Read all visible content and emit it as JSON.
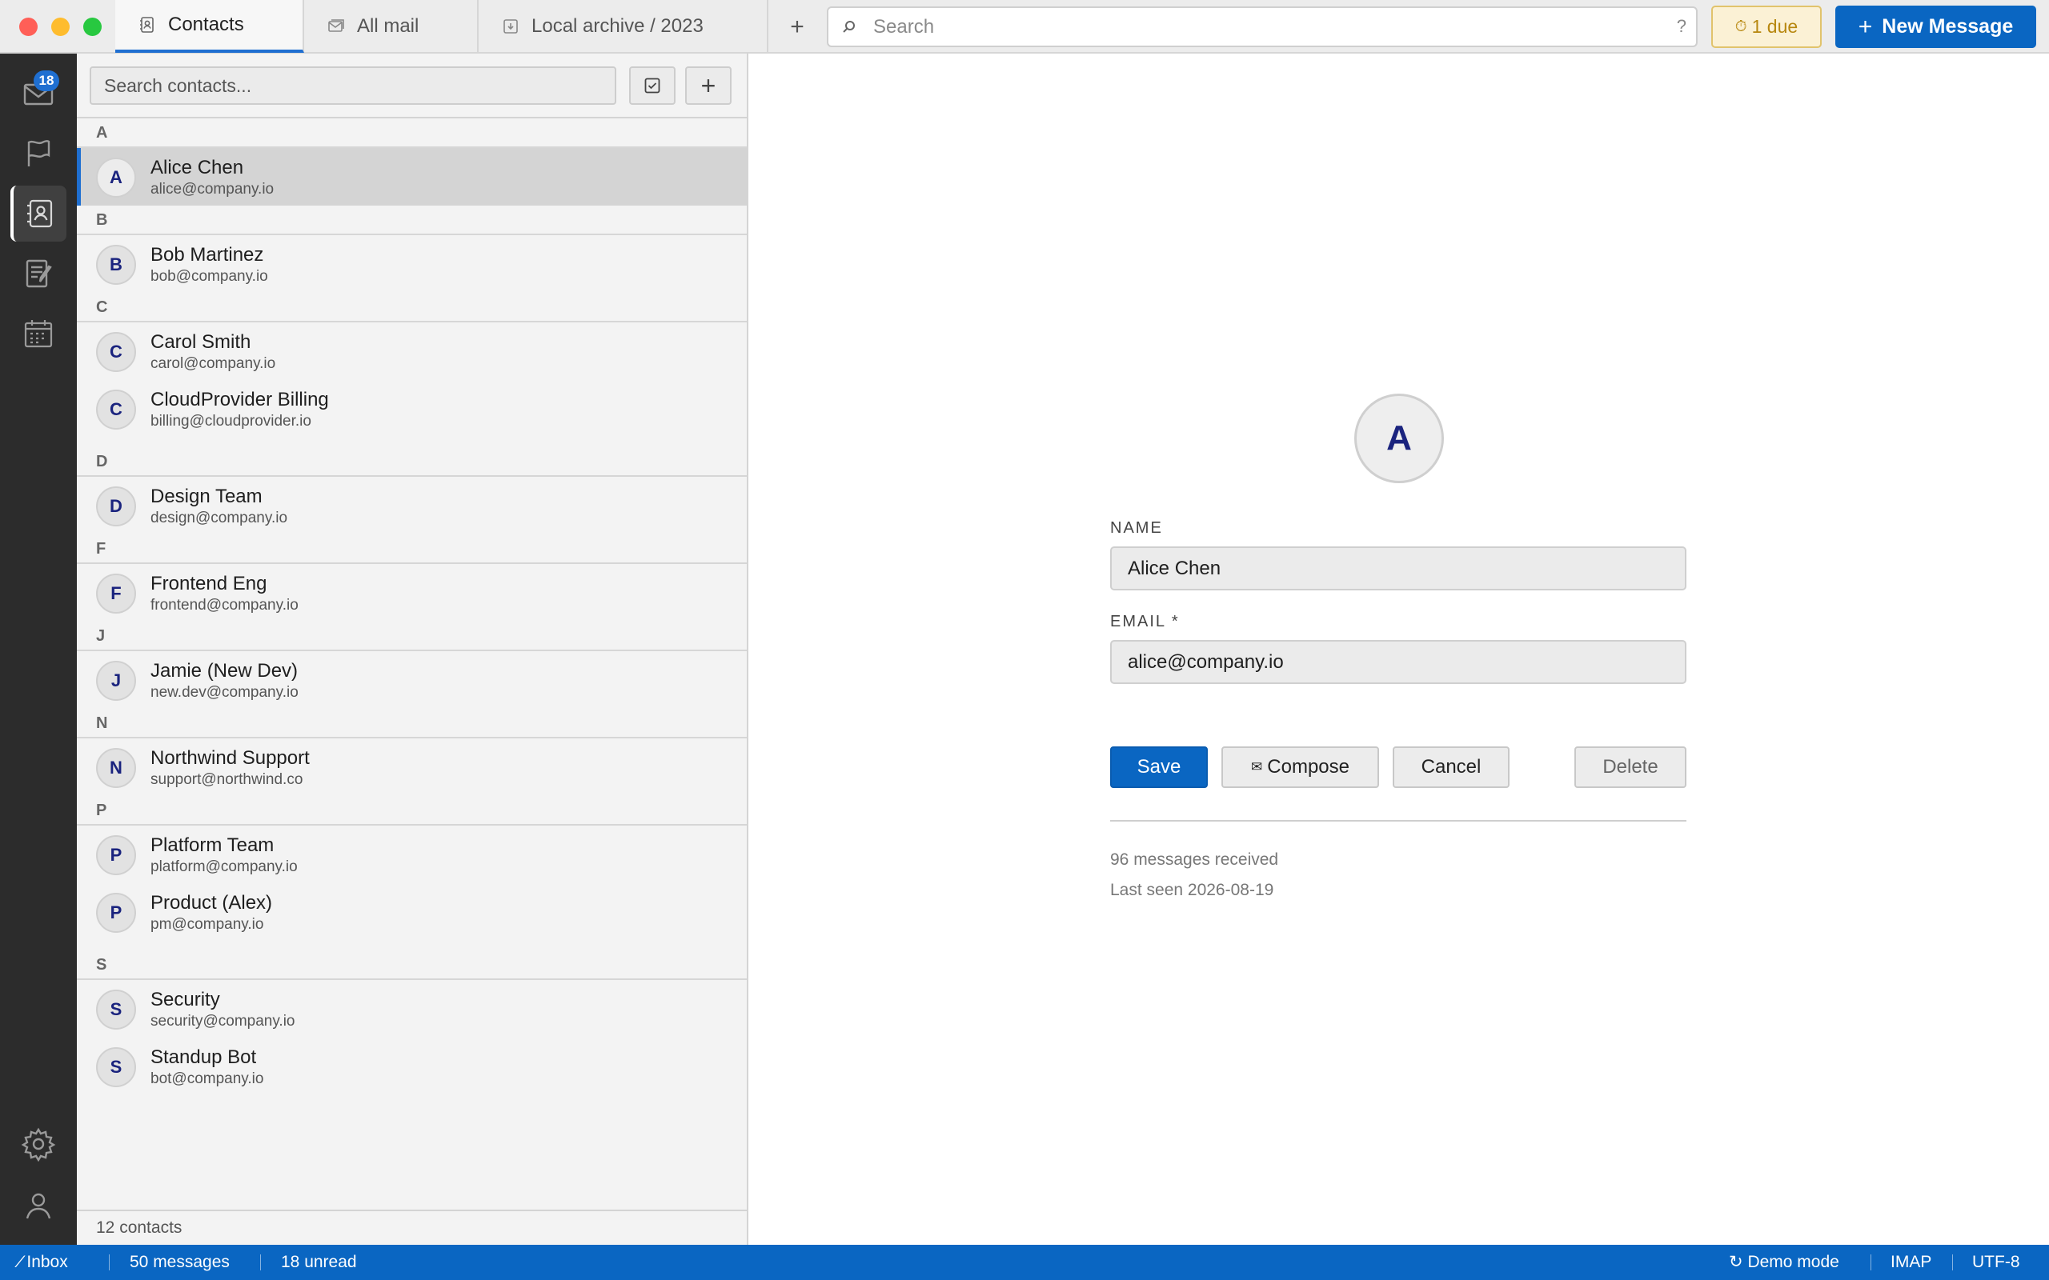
{
  "tabs": [
    {
      "label": "Contacts",
      "icon": "contacts-icon",
      "active": true
    },
    {
      "label": "All mail",
      "icon": "mailbox-icon",
      "active": false
    },
    {
      "label": "Local archive / 2023",
      "icon": "archive-icon",
      "active": false
    }
  ],
  "toolbar": {
    "add_tab_label": "+",
    "search_placeholder": "Search",
    "search_help": "?",
    "due_label": "1 due",
    "new_message_label": "New Message"
  },
  "rail": {
    "mail_badge": "18",
    "items": [
      "mail-icon",
      "flag-icon",
      "contacts-icon",
      "notes-icon",
      "calendar-icon",
      "settings-icon",
      "account-icon"
    ]
  },
  "contacts_panel": {
    "search_placeholder": "Search contacts...",
    "add_label": "+",
    "groups": [
      {
        "letter": "A",
        "contacts": [
          {
            "initial": "A",
            "name": "Alice Chen",
            "email": "alice@company.io",
            "selected": true
          }
        ]
      },
      {
        "letter": "B",
        "contacts": [
          {
            "initial": "B",
            "name": "Bob Martinez",
            "email": "bob@company.io"
          }
        ]
      },
      {
        "letter": "C",
        "contacts": [
          {
            "initial": "C",
            "name": "Carol Smith",
            "email": "carol@company.io"
          },
          {
            "initial": "C",
            "name": "CloudProvider Billing",
            "email": "billing@cloudprovider.io"
          }
        ]
      },
      {
        "letter": "D",
        "contacts": [
          {
            "initial": "D",
            "name": "Design Team",
            "email": "design@company.io"
          }
        ]
      },
      {
        "letter": "F",
        "contacts": [
          {
            "initial": "F",
            "name": "Frontend Eng",
            "email": "frontend@company.io"
          }
        ]
      },
      {
        "letter": "J",
        "contacts": [
          {
            "initial": "J",
            "name": "Jamie (New Dev)",
            "email": "new.dev@company.io"
          }
        ]
      },
      {
        "letter": "N",
        "contacts": [
          {
            "initial": "N",
            "name": "Northwind Support",
            "email": "support@northwind.co"
          }
        ]
      },
      {
        "letter": "P",
        "contacts": [
          {
            "initial": "P",
            "name": "Platform Team",
            "email": "platform@company.io"
          },
          {
            "initial": "P",
            "name": "Product (Alex)",
            "email": "pm@company.io"
          }
        ]
      },
      {
        "letter": "S",
        "contacts": [
          {
            "initial": "S",
            "name": "Security",
            "email": "security@company.io"
          },
          {
            "initial": "S",
            "name": "Standup Bot",
            "email": "bot@company.io"
          }
        ]
      }
    ],
    "footer": "12 contacts"
  },
  "detail": {
    "avatar_initial": "A",
    "name_label": "NAME",
    "name_value": "Alice Chen",
    "email_label": "EMAIL *",
    "email_value": "alice@company.io",
    "save_label": "Save",
    "compose_label": "Compose",
    "cancel_label": "Cancel",
    "delete_label": "Delete",
    "messages_received": "96 messages received",
    "last_seen": "Last seen 2026-08-19"
  },
  "statusbar": {
    "folder": "Inbox",
    "messages": "50 messages",
    "unread": "18 unread",
    "mode": "Demo mode",
    "protocol": "IMAP",
    "encoding": "UTF-8"
  },
  "colors": {
    "accent": "#0a66c2",
    "rail_bg": "#2c2c2c",
    "due_bg": "#fbf1d5",
    "due_text": "#b7870f",
    "avatar_text": "#1a237e"
  }
}
